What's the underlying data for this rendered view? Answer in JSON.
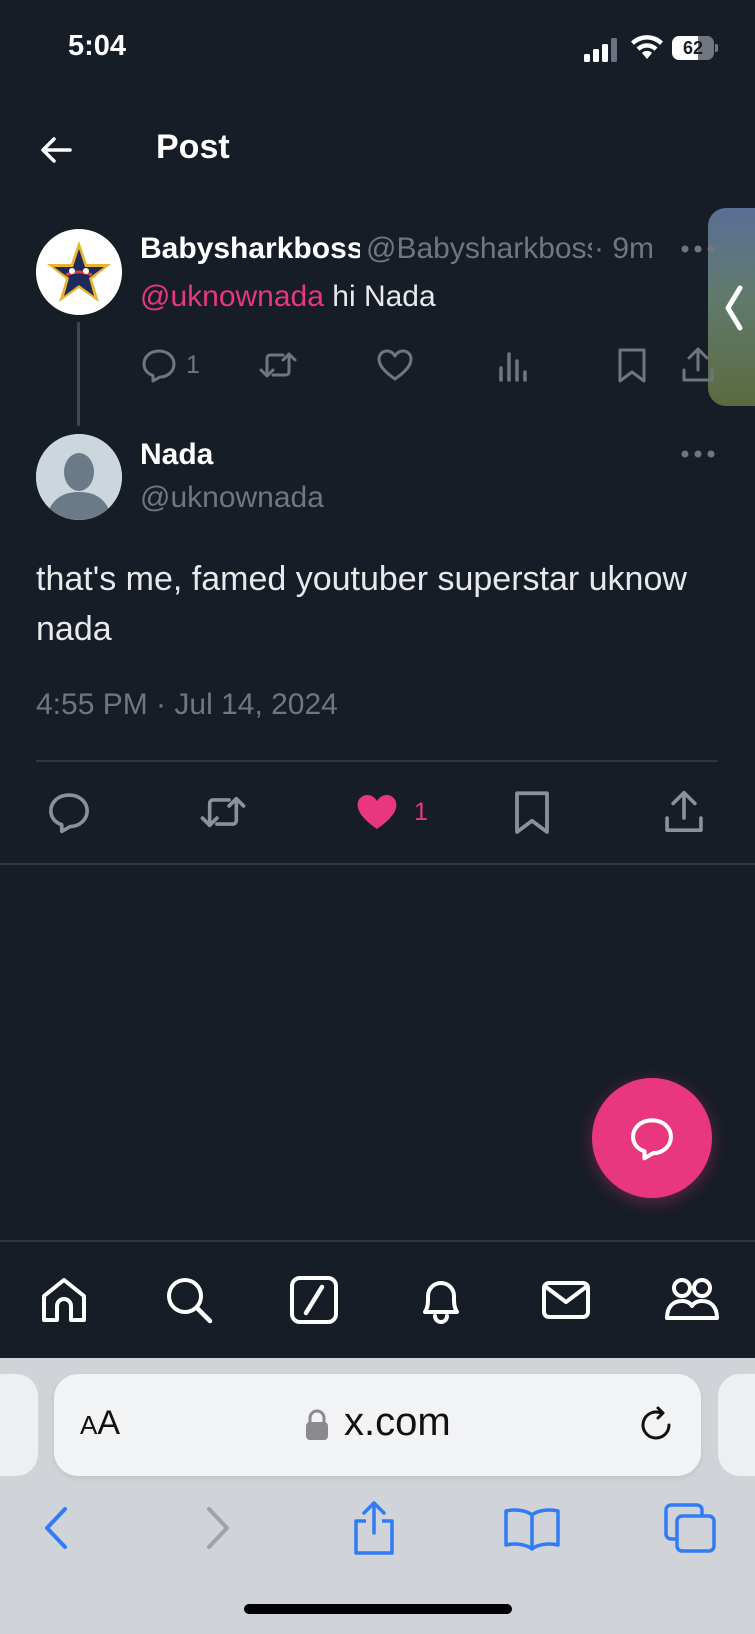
{
  "status_bar": {
    "time": "5:04",
    "battery": "62",
    "battery_level": 0.62
  },
  "header": {
    "title": "Post"
  },
  "parent_tweet": {
    "name": "Babysharkboss",
    "handle": "@Babysharkboss",
    "time": "· 9m",
    "mention": "@uknownada",
    "text": " hi Nada",
    "reply_count": "1"
  },
  "main_tweet": {
    "name": "Nada",
    "handle": "@uknownada",
    "text": "that's me, famed youtuber superstar uknow nada",
    "timestamp": "4:55 PM · Jul 14, 2024",
    "like_count": "1",
    "liked": true
  },
  "colors": {
    "accent": "#e8367f",
    "background": "#171d27",
    "muted": "#71767b"
  },
  "tab_bar": {
    "items": [
      "home-icon",
      "search-icon",
      "grok-icon",
      "notifications-icon",
      "messages-icon",
      "communities-icon"
    ]
  },
  "browser": {
    "text_size_small": "A",
    "text_size_big": "A",
    "url": "x.com"
  }
}
